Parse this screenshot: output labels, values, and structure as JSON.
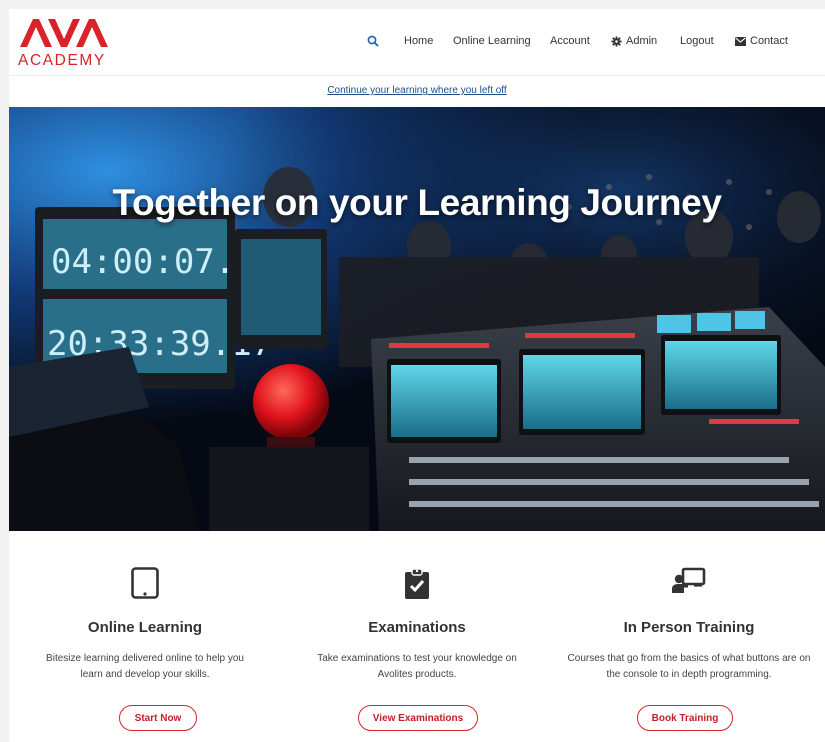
{
  "brand": {
    "logo_text": "AVA",
    "logo_subtext": "ACADEMY",
    "accent_color": "#d9222a"
  },
  "nav": {
    "search_icon": "search-icon",
    "items": [
      {
        "label": "Home"
      },
      {
        "label": "Online Learning"
      },
      {
        "label": "Account"
      },
      {
        "label": "Admin",
        "icon": "gear-icon"
      },
      {
        "label": "Logout"
      },
      {
        "label": "Contact",
        "icon": "envelope-icon"
      }
    ]
  },
  "continue_link": "Continue your learning where you left off",
  "hero": {
    "title": "Together on your Learning Journey",
    "timecode_top": "04:00:07.07",
    "timecode_bottom": "20:33:39.17"
  },
  "features": [
    {
      "icon": "tablet-icon",
      "title": "Online Learning",
      "description": "Bitesize learning delivered online to help you learn and develop your skills.",
      "button": "Start Now"
    },
    {
      "icon": "clipboard-check-icon",
      "title": "Examinations",
      "description": "Take examinations to test your knowledge on Avolites products.",
      "button": "View Examinations"
    },
    {
      "icon": "chalkboard-teacher-icon",
      "title": "In Person Training",
      "description": "Courses that go from the basics of what buttons are on the console to in depth programming.",
      "button": "Book Training"
    }
  ]
}
